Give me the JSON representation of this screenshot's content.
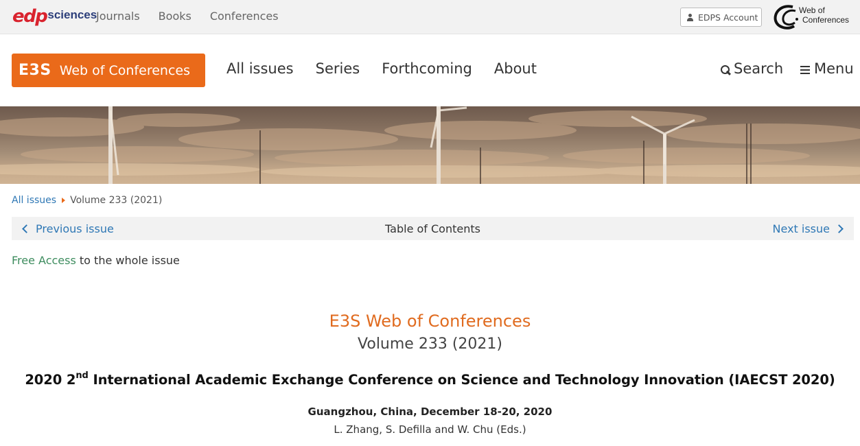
{
  "topbar": {
    "logo_edp": "edp",
    "logo_sciences": "sciences",
    "links": [
      "Journals",
      "Books",
      "Conferences"
    ],
    "account_label": "EDPS Account",
    "wc_logo_line1": "Web of",
    "wc_logo_line2": "Conferences"
  },
  "header": {
    "brand_short": "E3S",
    "brand_long": "Web of Conferences",
    "nav": [
      "All issues",
      "Series",
      "Forthcoming",
      "About"
    ],
    "search_label": "Search",
    "menu_label": "Menu"
  },
  "breadcrumb": {
    "link": "All issues",
    "current": "Volume 233 (2021)"
  },
  "issue_nav": {
    "prev": "Previous issue",
    "center": "Table of Contents",
    "next": "Next issue"
  },
  "free_access": {
    "link": "Free Access",
    "rest": " to the whole issue"
  },
  "issue": {
    "journal": "E3S Web of Conferences",
    "volume": "Volume 233 (2021)",
    "conf_pre": "2020 2",
    "conf_sup": "nd",
    "conf_post": " International Academic Exchange Conference on Science and Technology Innovation (IAECST 2020)",
    "location": "Guangzhou, China, December 18-20, 2020",
    "editors": "L. Zhang, S. Defilla and W. Chu (Eds.)"
  },
  "colors": {
    "brand_orange": "#ea6a1a",
    "link_blue": "#2f78b5",
    "free_green": "#3d8c5e"
  }
}
